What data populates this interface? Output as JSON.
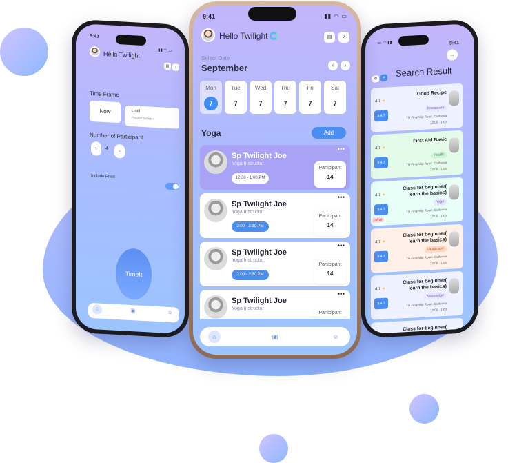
{
  "colors": {
    "accent": "#4a8ef0",
    "highlight_card": "#a9a3f5",
    "background_blob": "#9fb6ff"
  },
  "center": {
    "time": "9:41",
    "greeting": "Hello Twilight",
    "select_label": "Select Date",
    "month": "September",
    "days": [
      {
        "name": "Mon",
        "num": "7"
      },
      {
        "name": "Tue",
        "num": "7"
      },
      {
        "name": "Wed",
        "num": "7"
      },
      {
        "name": "Thu",
        "num": "7"
      },
      {
        "name": "Fri",
        "num": "7"
      },
      {
        "name": "Sat",
        "num": "7"
      }
    ],
    "category": "Yoga",
    "add_label": "Add",
    "cards": [
      {
        "name": "Sp Twilight Joe",
        "role": "Yoga Instructor",
        "time": "12:30 - 1:00 PM",
        "participant_label": "Participant",
        "participant_count": "14"
      },
      {
        "name": "Sp Twilight Joe",
        "role": "Yoga Instructor",
        "time": "2:00 - 2:30 PM",
        "participant_label": "Participant",
        "participant_count": "14"
      },
      {
        "name": "Sp Twilight Joe",
        "role": "Yoga Instructor",
        "time": "3:00 - 3:30 PM",
        "participant_label": "Participant",
        "participant_count": "14"
      },
      {
        "name": "Sp Twilight Joe",
        "role": "Yoga Instructor",
        "participant_label": "Participant"
      }
    ],
    "more_icon": "•••"
  },
  "left": {
    "time": "9:41",
    "greeting": "Hello Twilight",
    "time_frame_label": "Time Frame",
    "now_label": "Now",
    "until_label": "Until",
    "until_placeholder": "Please Select",
    "participants_label": "Number of Participant",
    "plus": "+",
    "minus": "-",
    "count": "4",
    "include_food": "Include Food",
    "timeit_label": "TimeIt"
  },
  "right": {
    "time": "9:41",
    "title": "Search Result",
    "cards": [
      {
        "title": "Good Recipe",
        "tag": "Restaurant",
        "address": "Tie Fin philip Road, California",
        "hours": "12:00 - 1:00",
        "rating": "4.7",
        "price": "$ 4.7"
      },
      {
        "title": "First Aid Basic",
        "tag": "Health",
        "address": "Tie Fin philip Road, California",
        "hours": "12:00 - 1:00",
        "rating": "4.7",
        "price": "$ 4.7"
      },
      {
        "title": "Class for beginner( learn the basics)",
        "tag": "Yoga",
        "address": "Tie Fin philip Road, California",
        "hours": "12:00 - 1:00",
        "rating": "4.7",
        "price": "$ 4.7",
        "discount": "-$5 off"
      },
      {
        "title": "Class for beginner( learn the basics)",
        "tag": "Landscape",
        "address": "Tie Fin philip Road, California",
        "hours": "12:00 - 1:00",
        "rating": "4.7",
        "price": "$ 4.7"
      },
      {
        "title": "Class for beginner( learn the basics)",
        "tag": "Knowledge",
        "address": "Tie Fin philip Road, California",
        "hours": "12:00 - 1:00",
        "rating": "4.7",
        "price": "$ 4.7"
      },
      {
        "title": "Class for beginner("
      }
    ]
  }
}
